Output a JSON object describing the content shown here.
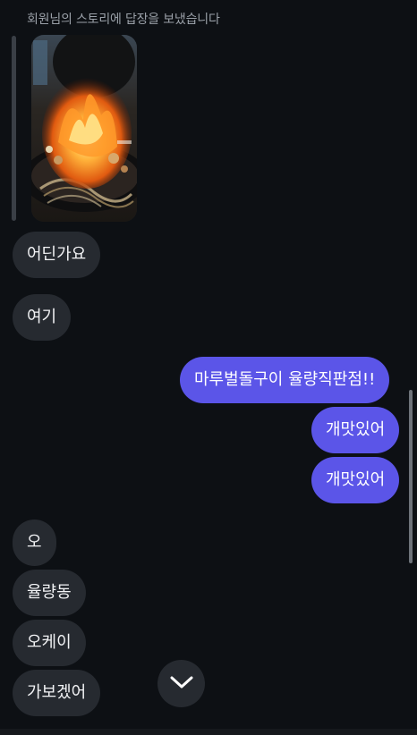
{
  "story_reply": {
    "caption": "회원님의 스토리에 답장을 보냈습니다"
  },
  "messages": [
    {
      "from": "them",
      "text": "어딘가요"
    },
    {
      "from": "them",
      "text": "여기"
    },
    {
      "from": "me",
      "text": "마루벌돌구이 율량직판점!!"
    },
    {
      "from": "me",
      "text": "개맛있어"
    },
    {
      "from": "me",
      "text": "개맛있어"
    },
    {
      "from": "them",
      "text": "오"
    },
    {
      "from": "them",
      "text": "율량동"
    },
    {
      "from": "them",
      "text": "오케이"
    },
    {
      "from": "them",
      "text": "가보겠어"
    }
  ],
  "icons": {
    "scroll_down": "chevron-down-icon"
  },
  "colors": {
    "background": "#0d1014",
    "incoming_bubble": "#262a30",
    "outgoing_bubble": "#5b55e8"
  }
}
